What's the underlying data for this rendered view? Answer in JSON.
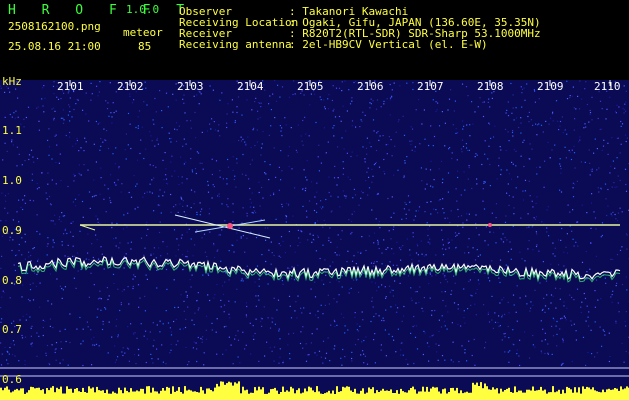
{
  "app": {
    "name": "H R O F F T",
    "version": "1.0.0"
  },
  "file": {
    "filename": "2508162100.png",
    "datetime": "25.08.16 21:00"
  },
  "meteor": {
    "label": "meteor",
    "count": "85"
  },
  "info": [
    {
      "key": "Observer",
      "value": ": Takanori Kawachi"
    },
    {
      "key": "Receiving Location",
      "value": ": Ogaki, Gifu, JAPAN (136.60E, 35.35N)"
    },
    {
      "key": "Receiver",
      "value": ": R820T2(RTL-SDR) SDR-Sharp 53.1000MHz"
    },
    {
      "key": "Receiving antenna",
      "value": ": 2el-HB9CV Vertical (el. E-W)"
    }
  ],
  "y_axis": {
    "unit": "kHz",
    "ticks": [
      "1.1",
      "1.0",
      "0.9",
      "0.8",
      "0.7",
      "0.6"
    ]
  },
  "x_axis": {
    "ticks": [
      "2101",
      "2102",
      "2103",
      "2104",
      "2105",
      "2106",
      "2107",
      "2108",
      "2109",
      "2110"
    ]
  },
  "colors": {
    "background": "#000000",
    "plot_bg": "#0a0a55",
    "accent_green": "#3cff3c",
    "accent_yellow": "#ffff40",
    "trace": "#ffffff"
  }
}
